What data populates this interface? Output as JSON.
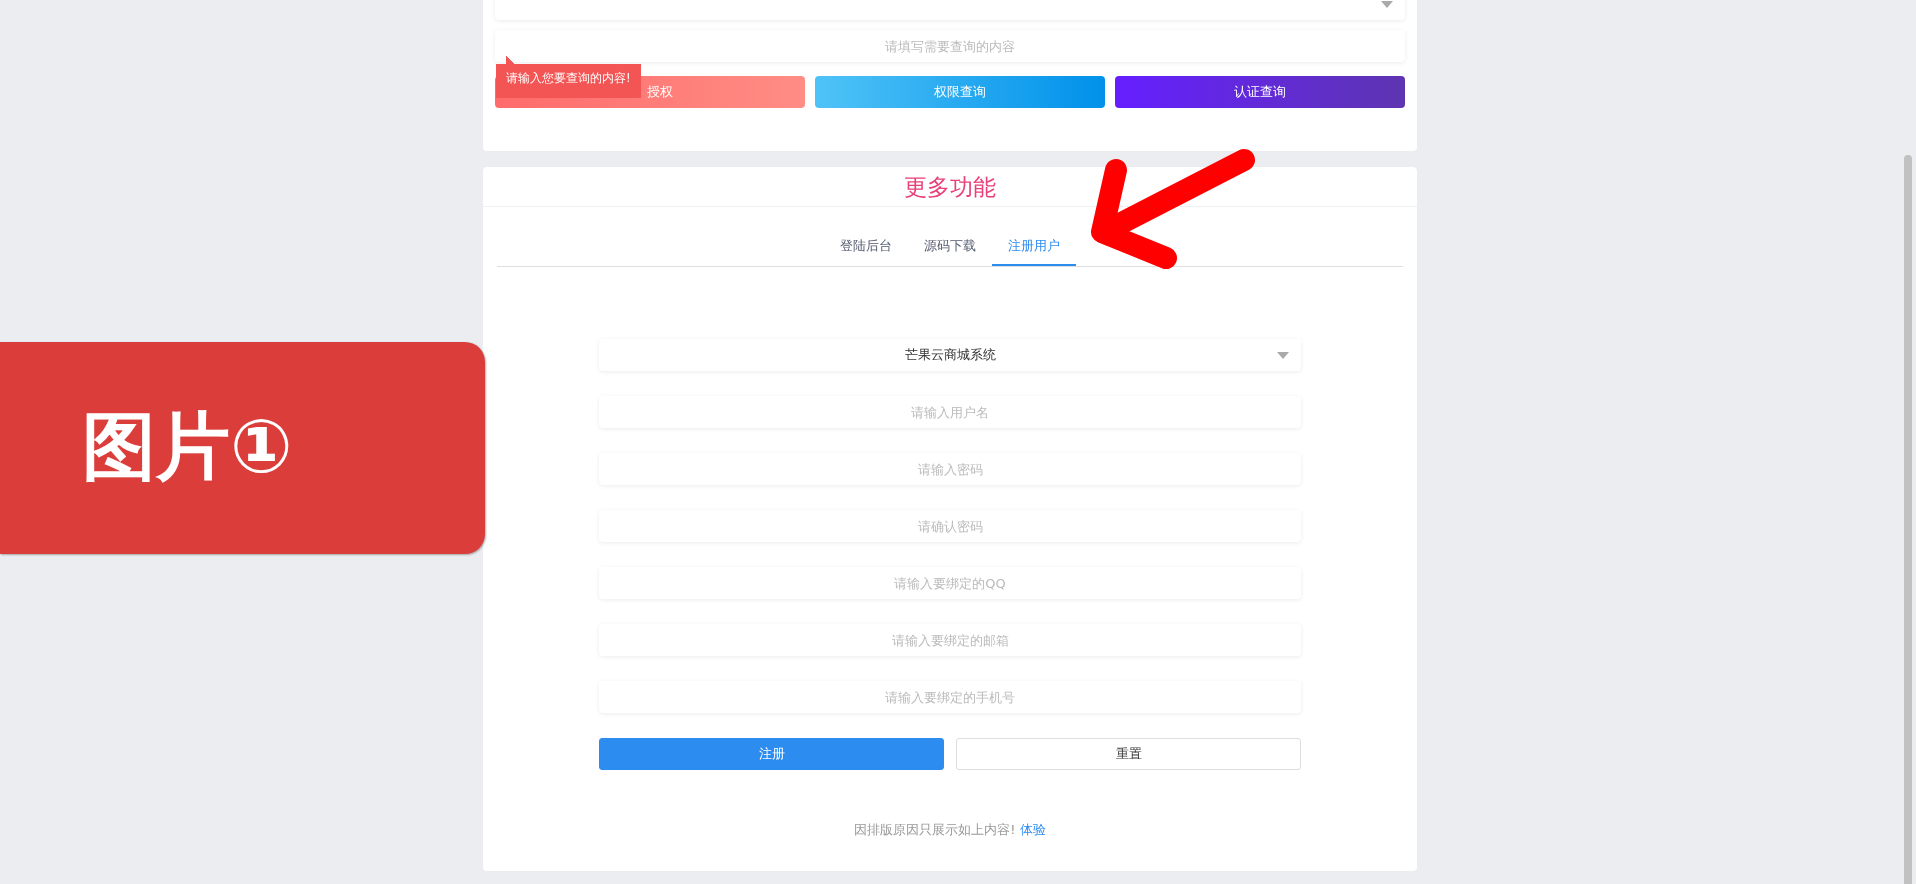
{
  "query_card": {
    "query_field": {
      "placeholder": "请填写需要查询的内容"
    },
    "buttons": [
      {
        "label": "授权",
        "kind": "coral"
      },
      {
        "label": "权限查询",
        "kind": "sky"
      },
      {
        "label": "认证查询",
        "kind": "violet"
      }
    ],
    "tooltip": "请输入您要查询的内容!"
  },
  "more_card": {
    "title": "更多功能",
    "tabs": [
      {
        "label": "登陆后台",
        "selected": false
      },
      {
        "label": "源码下载",
        "selected": false
      },
      {
        "label": "注册用户",
        "selected": true
      }
    ],
    "system_select": {
      "value": "芒果云商城系统"
    },
    "fields": [
      {
        "placeholder": "请输入用户名"
      },
      {
        "placeholder": "请输入密码"
      },
      {
        "placeholder": "请确认密码"
      },
      {
        "placeholder": "请输入要绑定的QQ"
      },
      {
        "placeholder": "请输入要绑定的邮箱"
      },
      {
        "placeholder": "请输入要绑定的手机号"
      }
    ],
    "buttons": [
      {
        "label": "注册",
        "kind": "primary"
      },
      {
        "label": "重置",
        "kind": "plain"
      }
    ],
    "note": {
      "text": "因排版原因只展示如上内容!",
      "link": "体验"
    }
  },
  "annotation": {
    "label": "图片①"
  }
}
